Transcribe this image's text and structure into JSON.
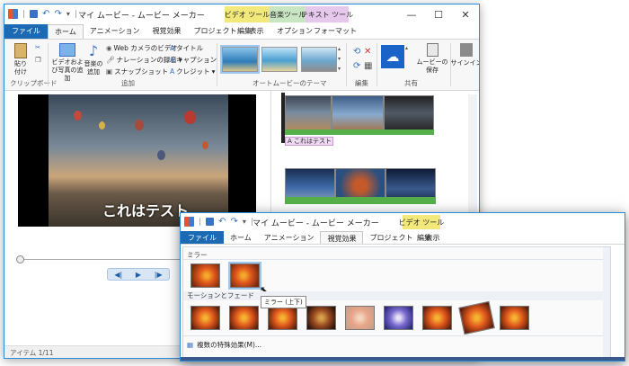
{
  "main": {
    "title": "マイ ムービー - ムービー メーカー",
    "context_tabs": [
      "ビデオ ツール",
      "音楽ツール",
      "テキスト ツール"
    ],
    "tabs": [
      "ファイル",
      "ホーム",
      "アニメーション",
      "視覚効果",
      "プロジェクト",
      "表示",
      "編集",
      "オプション",
      "フォーマット"
    ],
    "ribbon": {
      "paste": "貼り付け",
      "clipboard": "クリップボード",
      "add_video_photo": "ビデオおよび写真の追加",
      "add_music": "音楽の追加",
      "webcam_video": "Web カメラのビデオ",
      "narration": "ナレーションの録音",
      "snapshot": "スナップショット",
      "title": "タイトル",
      "caption": "キャプション",
      "credit": "クレジット",
      "add_group": "追加",
      "automovie_themes": "オートムービーのテーマ",
      "edit_group": "編集",
      "save_movie": "ムービーの保存",
      "share_group": "共有",
      "sign_in": "サインイン"
    },
    "preview_caption": "これはテスト",
    "timeline_caption": "A これはテスト",
    "status": "アイテム 1/11"
  },
  "popup": {
    "title": "マイ ムービー - ムービー メーカー",
    "context_tab": "ビデオ ツール",
    "tabs": [
      "ファイル",
      "ホーム",
      "アニメーション",
      "視覚効果",
      "プロジェクト",
      "表示",
      "編集"
    ],
    "mirror_section": "ミラー",
    "motion_section": "モーションとフェード",
    "tooltip": "ミラー (上下)",
    "multiple_effects": "複数の特殊効果(M)..."
  },
  "colors": {
    "file_tab": "#1d6ab4",
    "video_tools": "#f3e87a",
    "music_tools": "#c9e6c2",
    "text_tools": "#e5c8ec",
    "timeline_audio": "#55b04a",
    "selection": "#9ec8ef"
  }
}
